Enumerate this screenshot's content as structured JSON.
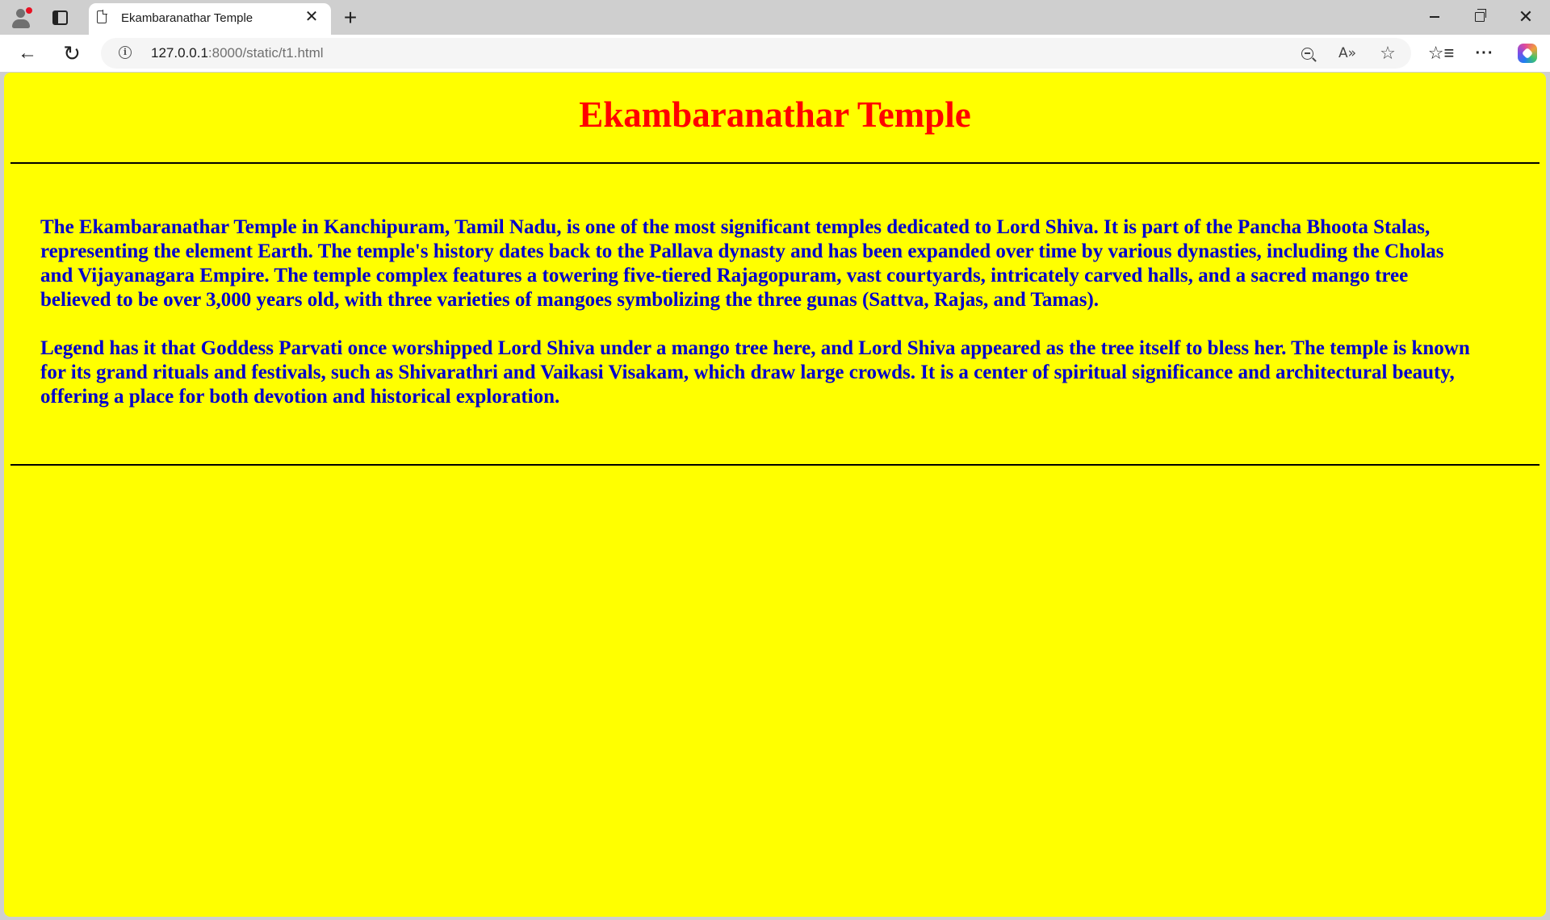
{
  "browser": {
    "tab": {
      "title": "Ekambaranathar Temple",
      "close_glyph": "✕"
    },
    "new_tab_glyph": "+",
    "window": {
      "close_glyph": "✕"
    },
    "toolbar": {
      "back_glyph": "←",
      "reload_glyph": "↻",
      "info_glyph": "i",
      "url_host": "127.0.0.1",
      "url_rest": ":8000/static/t1.html",
      "read_aloud_glyph": "A»",
      "favorite_glyph": "☆",
      "favorites_glyph": "☆≡",
      "more_glyph": "···"
    }
  },
  "page": {
    "background_color": "#ffff00",
    "title": "Ekambaranathar Temple",
    "title_color": "#ff0000",
    "text_color": "#0000cc",
    "paragraphs": [
      "The Ekambaranathar Temple in Kanchipuram, Tamil Nadu, is one of the most significant temples dedicated to Lord Shiva. It is part of the Pancha Bhoota Stalas, representing the element Earth. The temple's history dates back to the Pallava dynasty and has been expanded over time by various dynasties, including the Cholas and Vijayanagara Empire. The temple complex features a towering five-tiered Rajagopuram, vast courtyards, intricately carved halls, and a sacred mango tree believed to be over 3,000 years old, with three varieties of mangoes symbolizing the three gunas (Sattva, Rajas, and Tamas).",
      "Legend has it that Goddess Parvati once worshipped Lord Shiva under a mango tree here, and Lord Shiva appeared as the tree itself to bless her. The temple is known for its grand rituals and festivals, such as Shivarathri and Vaikasi Visakam, which draw large crowds. It is a center of spiritual significance and architectural beauty, offering a place for both devotion and historical exploration."
    ]
  }
}
